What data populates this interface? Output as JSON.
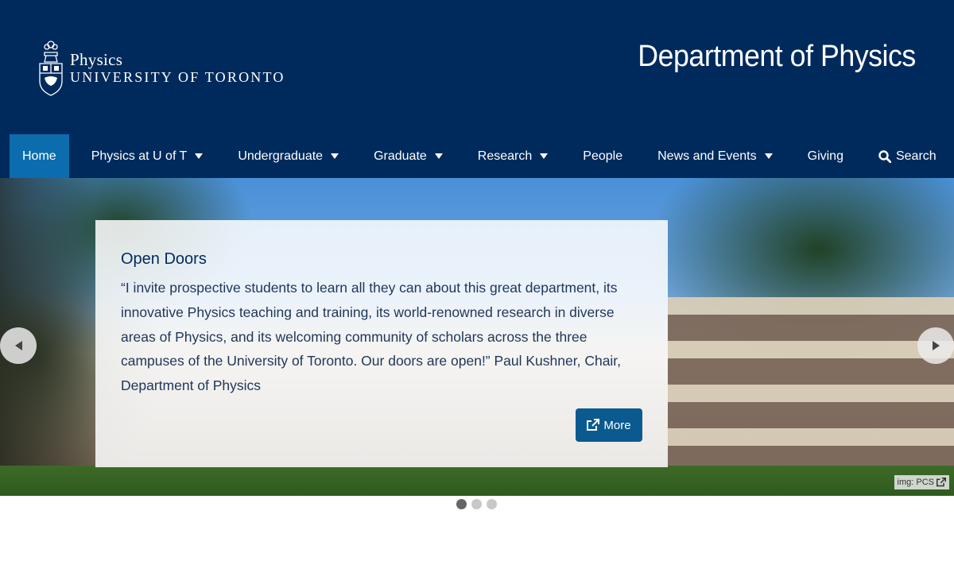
{
  "header": {
    "logo": {
      "sub": "Physics",
      "main": "UNIVERSITY OF TORONTO"
    },
    "title": "Department of Physics"
  },
  "nav": {
    "items": [
      {
        "label": "Home",
        "active": true
      },
      {
        "label": "Physics at U of T",
        "dropdown": true
      },
      {
        "label": "Undergraduate",
        "dropdown": true
      },
      {
        "label": "Graduate",
        "dropdown": true
      },
      {
        "label": "Research",
        "dropdown": true
      },
      {
        "label": "People"
      },
      {
        "label": "News and Events",
        "dropdown": true
      },
      {
        "label": "Giving"
      },
      {
        "label": "Search",
        "icon": "search-icon"
      }
    ]
  },
  "carousel": {
    "slide": {
      "title": "Open Doors",
      "text": "“I invite prospective students to learn all they can about this great department, its innovative Physics teaching and training, its world-renowned research in diverse areas of Physics, and its welcoming community of scholars across the three campuses of the University of Toronto. Our doors are open!” Paul Kushner, Chair, Department of Physics",
      "button_label": "More",
      "image_credit": "img: PCS"
    },
    "active_index": 0,
    "slide_count": 3
  },
  "colors": {
    "header_bg": "#002a5c",
    "nav_active_bg": "#0b6dae",
    "button_bg": "#0b5a8f"
  }
}
